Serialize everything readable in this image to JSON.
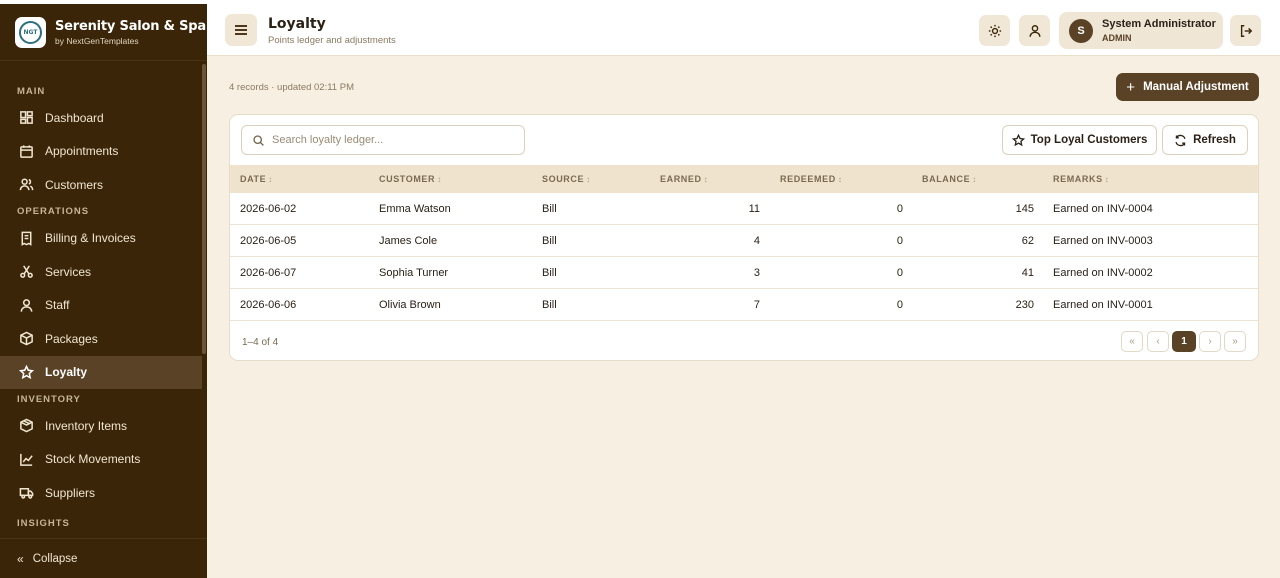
{
  "brand": {
    "logo_text": "NGT",
    "name": "Serenity Salon & Spa",
    "sub": "by NextGenTemplates"
  },
  "sidebar": {
    "sections": [
      {
        "label": "MAIN",
        "items": [
          {
            "label": "Dashboard",
            "icon": "dashboard-icon"
          },
          {
            "label": "Appointments",
            "icon": "calendar-icon"
          },
          {
            "label": "Customers",
            "icon": "users-icon"
          }
        ]
      },
      {
        "label": "OPERATIONS",
        "items": [
          {
            "label": "Billing & Invoices",
            "icon": "receipt-icon"
          },
          {
            "label": "Services",
            "icon": "scissors-icon"
          },
          {
            "label": "Staff",
            "icon": "user-icon"
          },
          {
            "label": "Packages",
            "icon": "box-icon"
          },
          {
            "label": "Loyalty",
            "icon": "star-icon",
            "active": true
          }
        ]
      },
      {
        "label": "INVENTORY",
        "items": [
          {
            "label": "Inventory Items",
            "icon": "package-icon"
          },
          {
            "label": "Stock Movements",
            "icon": "chart-line-icon"
          },
          {
            "label": "Suppliers",
            "icon": "truck-icon"
          }
        ]
      },
      {
        "label": "INSIGHTS",
        "items": []
      }
    ],
    "collapse_label": "Collapse"
  },
  "header": {
    "title": "Loyalty",
    "subtitle": "Points ledger and adjustments",
    "user": {
      "initial": "S",
      "name": "System Administrator",
      "role": "ADMIN"
    }
  },
  "main": {
    "records_info": "4 records · updated 02:11 PM",
    "manual_adjustment_label": "Manual Adjustment",
    "search_placeholder": "Search loyalty ledger...",
    "top_loyal_label": "Top Loyal Customers",
    "refresh_label": "Refresh",
    "columns": [
      "DATE",
      "CUSTOMER",
      "SOURCE",
      "EARNED",
      "REDEEMED",
      "BALANCE",
      "REMARKS"
    ],
    "rows": [
      [
        "2026-06-02",
        "Emma Watson",
        "Bill",
        "11",
        "0",
        "145",
        "Earned on INV-0004"
      ],
      [
        "2026-06-05",
        "James Cole",
        "Bill",
        "4",
        "0",
        "62",
        "Earned on INV-0003"
      ],
      [
        "2026-06-07",
        "Sophia Turner",
        "Bill",
        "3",
        "0",
        "41",
        "Earned on INV-0002"
      ],
      [
        "2026-06-06",
        "Olivia Brown",
        "Bill",
        "7",
        "0",
        "230",
        "Earned on INV-0001"
      ]
    ],
    "pagination": {
      "range": "1–4 of 4",
      "first": "«",
      "prev": "‹",
      "current": "1",
      "next": "›",
      "last": "»"
    }
  },
  "colors": {
    "sidebar_bg": "#3a2508",
    "accent": "#5a4226",
    "page_bg": "#f7f0e2",
    "table_head_bg": "#efe3cd"
  }
}
